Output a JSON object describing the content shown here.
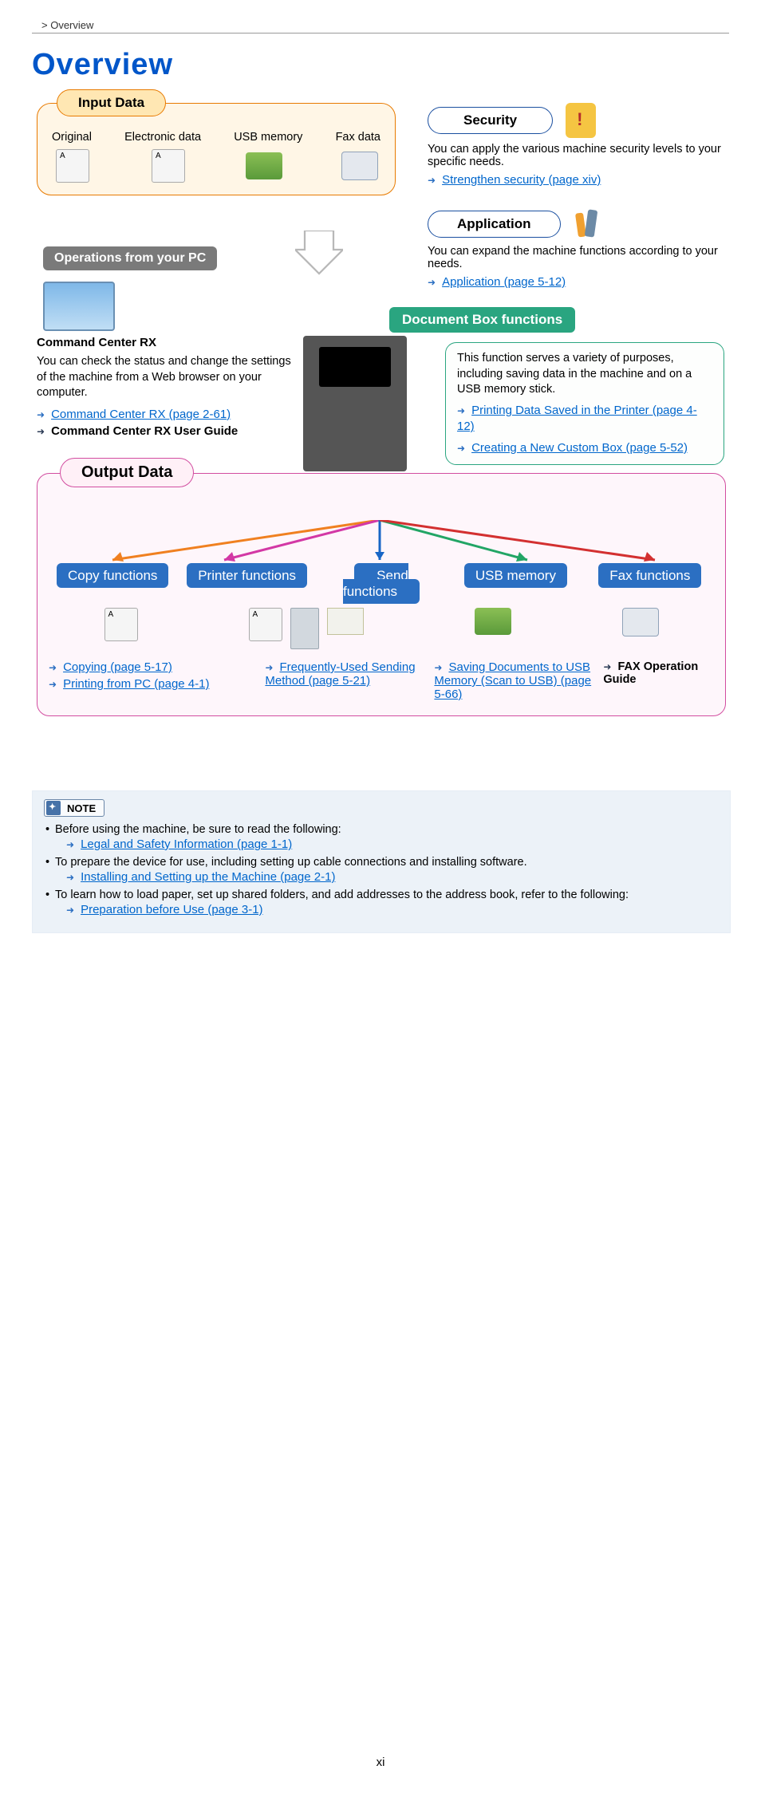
{
  "breadcrumb": " > Overview",
  "page_title": "Overview",
  "page_number": "xi",
  "input": {
    "heading": "Input Data",
    "cols": [
      "Original",
      "Electronic data",
      "USB memory",
      "Fax data"
    ]
  },
  "security": {
    "heading": "Security",
    "desc": "You can apply the various machine security levels to your specific needs.",
    "link": "Strengthen security (page xiv)"
  },
  "application": {
    "heading": "Application",
    "desc": "You can expand the machine functions according to your needs.",
    "link": "Application (page 5-12)"
  },
  "ops_pc": {
    "heading": "Operations from your PC"
  },
  "command_center": {
    "title": "Command Center RX",
    "desc": "You can check the status and change the settings of the machine from a Web browser on your computer.",
    "link1": "Command Center RX (page 2-61)",
    "link2": "Command Center RX User Guide"
  },
  "docbox": {
    "heading": "Document Box functions",
    "desc": "This function serves a variety of purposes, including saving data in the machine and on a USB memory stick.",
    "link1": "Printing Data Saved in the Printer (page 4-12)",
    "link2": "Creating a New Custom Box (page 5-52)"
  },
  "output": {
    "heading": "Output Data",
    "funcs": [
      "Copy functions",
      "Printer functions",
      "Send functions",
      "USB memory",
      "Fax functions"
    ],
    "col1_link1": "Copying (page 5-17)",
    "col1_link2": "Printing from PC (page 4-1)",
    "col2_link": "Frequently-Used Sending Method (page 5-21)",
    "col3_link": "Saving Documents to USB Memory (Scan to USB) (page 5-66)",
    "col4_text": "FAX Operation Guide"
  },
  "note": {
    "label": "NOTE",
    "item1": "Before using the machine, be sure to read the following:",
    "link1": "Legal and Safety Information (page 1-1)",
    "item2": "To prepare the device for use, including setting up cable connections and installing software.",
    "link2": "Installing and Setting up the Machine (page 2-1)",
    "item3": "To learn how to load paper, set up shared folders, and add addresses to the address book, refer to the following:",
    "link3": "Preparation before Use (page 3-1)"
  }
}
